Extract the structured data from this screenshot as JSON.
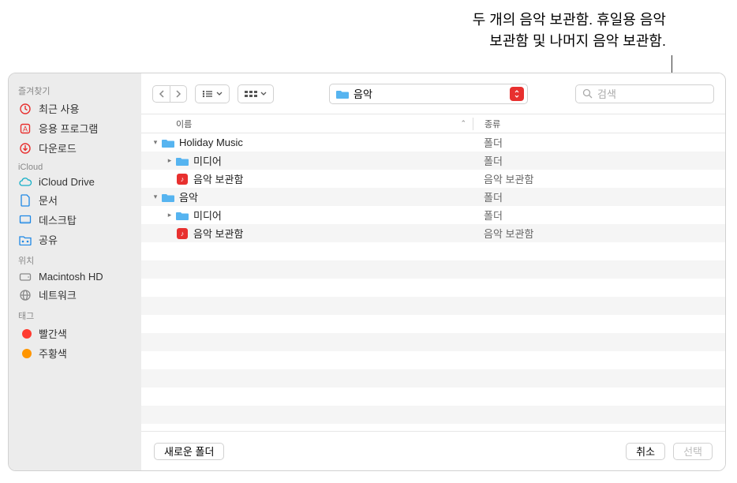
{
  "callout": {
    "line1": "두 개의 음악 보관함. 휴일용 음악",
    "line2": "보관함 및 나머지 음악 보관함."
  },
  "sidebar": {
    "sections": [
      {
        "header": "즐겨찾기",
        "items": [
          {
            "icon": "clock",
            "label": "최근 사용",
            "color": "#e8302f"
          },
          {
            "icon": "app",
            "label": "응용 프로그램",
            "color": "#e8302f"
          },
          {
            "icon": "download",
            "label": "다운로드",
            "color": "#e8302f"
          }
        ]
      },
      {
        "header": "iCloud",
        "items": [
          {
            "icon": "cloud",
            "label": "iCloud Drive",
            "color": "#16b0c8"
          },
          {
            "icon": "doc",
            "label": "문서",
            "color": "#1e88e5"
          },
          {
            "icon": "desktop",
            "label": "데스크탑",
            "color": "#1e88e5"
          },
          {
            "icon": "share",
            "label": "공유",
            "color": "#1e88e5"
          }
        ]
      },
      {
        "header": "위치",
        "items": [
          {
            "icon": "hdd",
            "label": "Macintosh HD",
            "color": "#888"
          },
          {
            "icon": "network",
            "label": "네트워크",
            "color": "#888"
          }
        ]
      },
      {
        "header": "태그",
        "items": [
          {
            "icon": "tag",
            "label": "빨간색",
            "color": "#ff3b30"
          },
          {
            "icon": "tag",
            "label": "주황색",
            "color": "#ff9500"
          }
        ]
      }
    ]
  },
  "toolbar": {
    "path_label": "음악",
    "search_placeholder": "검색"
  },
  "columns": {
    "name": "이름",
    "kind": "종류"
  },
  "rows": [
    {
      "depth": 0,
      "disclosure": "down",
      "icon": "folder",
      "name": "Holiday Music",
      "kind": "폴더"
    },
    {
      "depth": 1,
      "disclosure": "right",
      "icon": "folder",
      "name": "미디어",
      "kind": "폴더"
    },
    {
      "depth": 1,
      "disclosure": "",
      "icon": "musiclib",
      "name": "음악 보관함",
      "kind": "음악 보관함"
    },
    {
      "depth": 0,
      "disclosure": "down",
      "icon": "folder",
      "name": "음악",
      "kind": "폴더"
    },
    {
      "depth": 1,
      "disclosure": "right",
      "icon": "folder",
      "name": "미디어",
      "kind": "폴더"
    },
    {
      "depth": 1,
      "disclosure": "",
      "icon": "musiclib",
      "name": "음악 보관함",
      "kind": "음악 보관함"
    }
  ],
  "footer": {
    "new_folder": "새로운 폴더",
    "cancel": "취소",
    "select": "선택"
  }
}
